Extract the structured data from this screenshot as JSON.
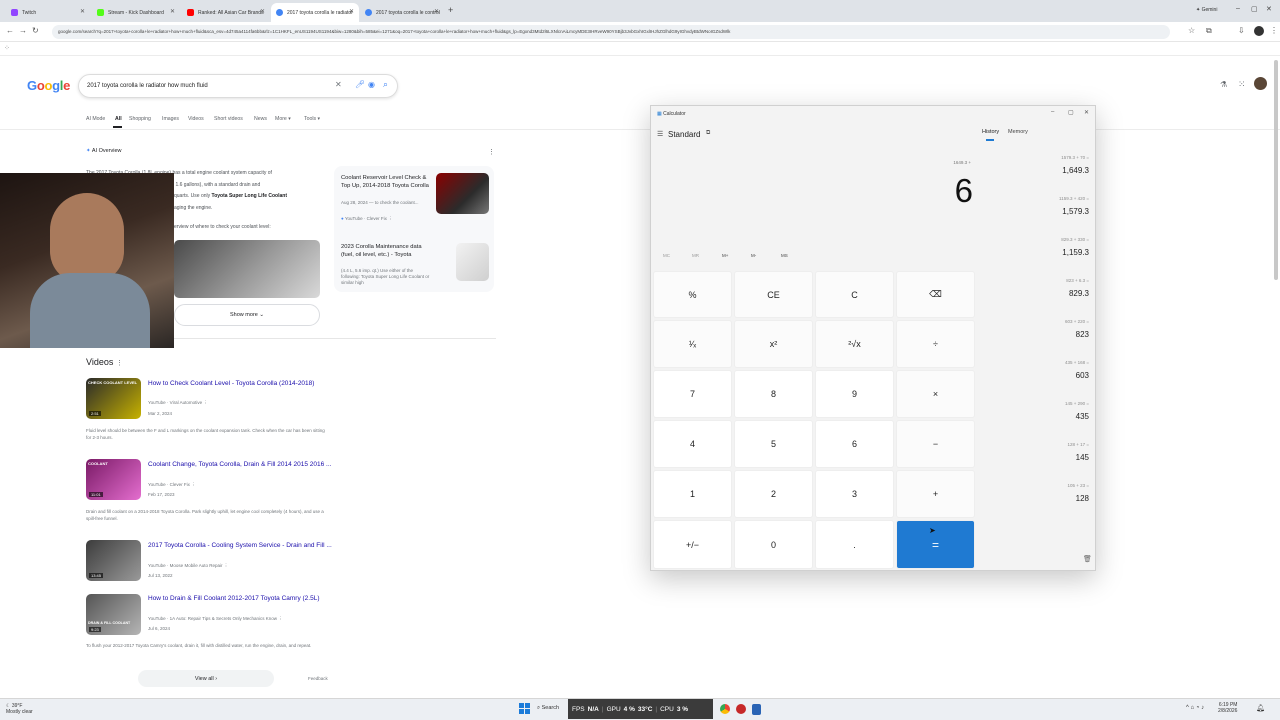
{
  "browser": {
    "tabs": [
      {
        "label": "Twitch",
        "color": "#9146ff"
      },
      {
        "label": "Stream - Kick Dashboard",
        "color": "#53fc18"
      },
      {
        "label": "Ranked: All Asian Car Brands",
        "color": "#ff0000"
      },
      {
        "label": "2017 toyota corolla le radiator",
        "color": "#4285f4"
      },
      {
        "label": "2017 toyota corolla le control",
        "color": "#4285f4"
      }
    ],
    "profile": "Gemini",
    "url": "google.com/search?q=2017+toyota+corolla+le+radiator+how+much+fluid&sca_esv=4d745a4114fa6bb&rlz=1C1HKFL_enUS1194US1194&biw=1280&bih=585&ei=1271&oq=2017+toyota+corolla+le+radiator+how+much+fluid&gs_lp=Egxnd3Mtd2l6LXNlcnAiLmcyMDE3IHRveW90YSBjb3JvbGxhIGxlIHJhZGlhdG9yIGhvdyBtdWNoIGZsdWlk"
  },
  "google": {
    "logo": "Google",
    "query": "2017 toyota corolla le radiator how much fluid",
    "nav": [
      "AI Mode",
      "All",
      "Shopping",
      "Images",
      "Videos",
      "Short videos",
      "News",
      "More ▾",
      "Tools ▾"
    ],
    "ai_overview": {
      "heading": "AI Overview",
      "line1": "The 2017 Toyota Corolla (1.8L engine) has a total engine coolant system capacity of",
      "line2": "(about 1.5 to 1.6 gallons), with a standard drain and",
      "line3": "quarts. Use only",
      "bold": "Toyota Super Long Life Coolant",
      "line4": "aging the engine.",
      "line5": "erview of where to check your coolant level:",
      "show_more": "Show more",
      "side_cards": [
        {
          "title": "Coolant Reservoir Level Check & Top Up, 2014-2018 Toyota Corolla",
          "meta": "Aug 28, 2024 — to check the coolant...",
          "source": "YouTube · Clever Fix"
        },
        {
          "title": "2023 Corolla Maintenance data (fuel, oil level, etc.) - Toyota",
          "meta": "(4.4 L, 5.6 imp. qt.) Use either of the following: Toyota Super Long Life Coolant or similar high"
        }
      ]
    },
    "videos": {
      "heading": "Videos",
      "items": [
        {
          "title": "How to Check Coolant Level - Toyota Corolla (2014-2018)",
          "source": "YouTube · Viral Automotive",
          "date": "Mar 2, 2024",
          "snippet": "Fluid level should be between the F and L markings on the coolant expansion tank. Check when the car has been sitting for 2-3 hours.",
          "duration": "2:51",
          "thumb_text": "CHECK COOLANT LEVEL"
        },
        {
          "title": "Coolant Change, Toyota Corolla, Drain & Fill 2014 2015 2016 ...",
          "source": "YouTube · Clever Fix",
          "date": "Feb 17, 2023",
          "snippet": "Drain and fill coolant on a 2014-2018 Toyota Corolla. Park slightly uphill, let engine cool completely (4 hours), and use a spill-free funnel.",
          "duration": "11:01",
          "thumb_text": "COOLANT"
        },
        {
          "title": "2017 Toyota Corolla - Cooling System Service - Drain and Fill ...",
          "source": "YouTube · Moose Mobile Auto Repair",
          "date": "Jul 13, 2022",
          "snippet": "",
          "duration": "13:45",
          "thumb_text": ""
        },
        {
          "title": "How to Drain & Fill Coolant 2012-2017 Toyota Camry (2.5L)",
          "source": "YouTube · 1A Auto: Repair Tips & Secrets Only Mechanics Know",
          "date": "Jul 6, 2024",
          "snippet": "To flush your 2012-2017 Toyota Camry's coolant, drain it, fill with distilled water, run the engine, drain, and repeat.",
          "duration": "9:23",
          "thumb_text": "DRAIN & FILL COOLANT"
        }
      ],
      "view_all": "View all",
      "feedback": "Feedback"
    }
  },
  "calculator": {
    "app_title": "Calculator",
    "mode": "Standard",
    "tabs": {
      "history": "History",
      "memory": "Memory"
    },
    "expression": "1649.3 +",
    "display": "6",
    "memory_buttons": [
      "MC",
      "MR",
      "M+",
      "M-",
      "MS"
    ],
    "keys": [
      [
        "%",
        "CE",
        "C",
        "⌫"
      ],
      [
        "¹∕ₓ",
        "x²",
        "²√x",
        "÷"
      ],
      [
        "7",
        "8",
        "9",
        "×"
      ],
      [
        "4",
        "5",
        "6",
        "−"
      ],
      [
        "1",
        "2",
        "3",
        "+"
      ],
      [
        "+/−",
        "0",
        ".",
        "="
      ]
    ],
    "history": [
      {
        "expr": "1579.3 + 70 =",
        "result": "1,649.3"
      },
      {
        "expr": "1159.3 + 420 =",
        "result": "1,579.3"
      },
      {
        "expr": "829.3 + 330 =",
        "result": "1,159.3"
      },
      {
        "expr": "823 + 6.3 =",
        "result": "829.3"
      },
      {
        "expr": "603 + 220 =",
        "result": "823"
      },
      {
        "expr": "435 + 168 =",
        "result": "603"
      },
      {
        "expr": "145 + 290 =",
        "result": "435"
      },
      {
        "expr": "128 + 17 =",
        "result": "145"
      },
      {
        "expr": "105 + 23 =",
        "result": "128"
      }
    ]
  },
  "taskbar": {
    "weather_temp": "39°F",
    "weather_desc": "Mostly clear",
    "search": "Search",
    "overlay": {
      "fps": "FPS",
      "fps_val": "N/A",
      "gpu": "GPU",
      "gpu_val": "4 %",
      "gpu_temp": "33°C",
      "cpu": "CPU",
      "cpu_val": "3 %"
    },
    "time": "6:19 PM",
    "date": "2/8/2026"
  }
}
